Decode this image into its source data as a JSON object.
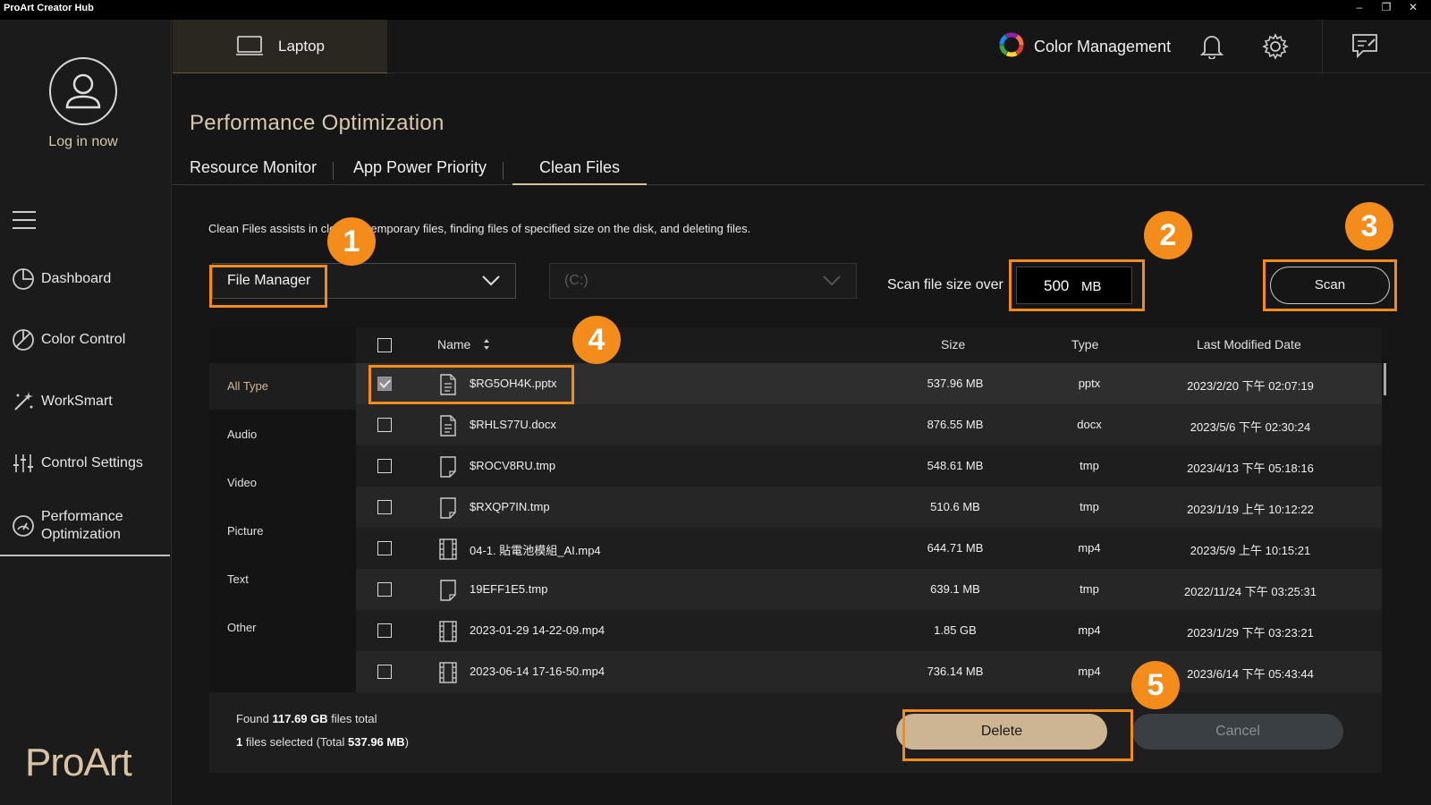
{
  "window": {
    "title": "ProArt Creator Hub",
    "controls": {
      "minimize": "–",
      "restore": "❐",
      "close": "✕"
    }
  },
  "sidebar": {
    "login": "Log in now",
    "items": [
      {
        "label": "Dashboard",
        "icon": "dashboard-icon"
      },
      {
        "label": "Color Control",
        "icon": "color-control-icon"
      },
      {
        "label": "WorkSmart",
        "icon": "worksmart-icon"
      },
      {
        "label": "Control Settings",
        "icon": "control-settings-icon"
      },
      {
        "label": "Performance\nOptimization",
        "icon": "performance-icon"
      }
    ],
    "brand": "ProArt"
  },
  "topbar": {
    "device": "Laptop",
    "color_management": "Color Management"
  },
  "page": {
    "title": "Performance Optimization",
    "tabs": [
      "Resource Monitor",
      "App Power Priority",
      "Clean Files"
    ],
    "description": "Clean Files assists in cleaning temporary files, finding files of specified size on the disk, and deleting files."
  },
  "controls": {
    "manager_dropdown": "File Manager",
    "drive_dropdown": "(C:)",
    "scan_label": "Scan file size over",
    "size_value": "500",
    "size_unit": "MB",
    "scan_button": "Scan"
  },
  "types": [
    "All Type",
    "Audio",
    "Video",
    "Picture",
    "Text",
    "Other"
  ],
  "table": {
    "headers": {
      "name": "Name",
      "size": "Size",
      "type": "Type",
      "date": "Last Modified Date"
    },
    "rows": [
      {
        "name": "$RG5OH4K.pptx",
        "size": "537.96 MB",
        "type": "pptx",
        "date": "2023/2/20 下午 02:07:19",
        "checked": true,
        "icon": "document-icon"
      },
      {
        "name": "$RHLS77U.docx",
        "size": "876.55 MB",
        "type": "docx",
        "date": "2023/5/6 下午 02:30:24",
        "checked": false,
        "icon": "document-icon"
      },
      {
        "name": "$ROCV8RU.tmp",
        "size": "548.61 MB",
        "type": "tmp",
        "date": "2023/4/13 下午 05:18:16",
        "checked": false,
        "icon": "blank-file-icon"
      },
      {
        "name": "$RXQP7IN.tmp",
        "size": "510.6 MB",
        "type": "tmp",
        "date": "2023/1/19 上午 10:12:22",
        "checked": false,
        "icon": "blank-file-icon"
      },
      {
        "name": "04-1. 貼電池模組_AI.mp4",
        "size": "644.71 MB",
        "type": "mp4",
        "date": "2023/5/9 上午 10:15:21",
        "checked": false,
        "icon": "video-file-icon"
      },
      {
        "name": "19EFF1E5.tmp",
        "size": "639.1 MB",
        "type": "tmp",
        "date": "2022/11/24 下午 03:25:31",
        "checked": false,
        "icon": "blank-file-icon"
      },
      {
        "name": "2023-01-29 14-22-09.mp4",
        "size": "1.85 GB",
        "type": "mp4",
        "date": "2023/1/29 下午 03:23:21",
        "checked": false,
        "icon": "video-file-icon"
      },
      {
        "name": "2023-06-14 17-16-50.mp4",
        "size": "736.14 MB",
        "type": "mp4",
        "date": "2023/6/14 下午 05:43:44",
        "checked": false,
        "icon": "video-file-icon"
      }
    ]
  },
  "footer": {
    "found_prefix": "Found ",
    "found_total": "117.69 GB",
    "found_suffix": " files total",
    "selected_count": "1",
    "selected_mid": " files selected (Total ",
    "selected_total": "537.96 MB",
    "selected_end": ")",
    "delete": "Delete",
    "cancel": "Cancel"
  },
  "callouts": [
    "1",
    "2",
    "3",
    "4",
    "5"
  ],
  "colors": {
    "accent": "#cdb594",
    "callout": "#f48c1c",
    "background": "#161616"
  }
}
